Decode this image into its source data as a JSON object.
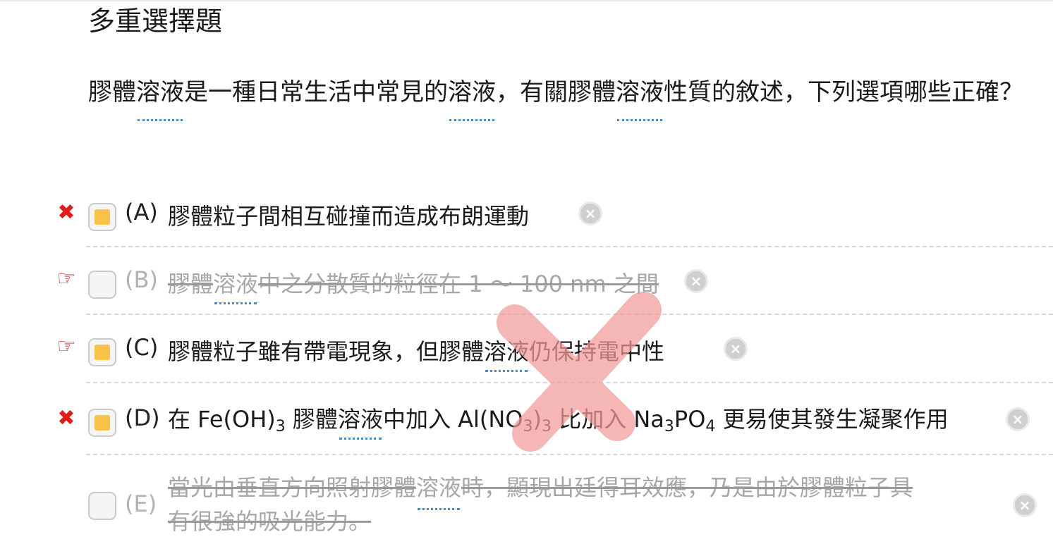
{
  "header": {
    "title": "多重選擇題"
  },
  "question": {
    "p1": "膠體",
    "u1": "溶液",
    "p2": "是一種日常生活中常見的",
    "u2": "溶液",
    "p3": "，有關膠體",
    "u3": "溶液",
    "p4": "性質的敘述，下列選項哪些正確？"
  },
  "options": [
    {
      "letter": "(A)",
      "text": "膠體粒子間相互碰撞而造成布朗運動",
      "mark": "wrong",
      "checked": true
    },
    {
      "letter": "(B)",
      "t1": "膠體",
      "u": "溶液",
      "t2": "中之分散質的粒徑在 1 ～ 100 nm 之間",
      "mark": "hand",
      "checked": false,
      "struck": true
    },
    {
      "letter": "(C)",
      "t1": "膠體粒子雖有帶電現象，但膠體",
      "u": "溶液",
      "t2": "仍保持電中性",
      "mark": "hand",
      "checked": true
    },
    {
      "letter": "(D)",
      "t1": "在 Fe(OH)",
      "s1": "3",
      "t2": " 膠體",
      "u": "溶液",
      "t3": "中加入 Al(NO",
      "s2": "3",
      "t4": ")",
      "s3": "3",
      "t5": " 比加入 Na",
      "s4": "3",
      "t6": "PO",
      "s5": "4",
      "t7": " 更易使其發生凝聚作用",
      "mark": "wrong",
      "checked": true
    },
    {
      "letter": "(E)",
      "t1": "當光由垂直方向照射膠體",
      "u": "溶液",
      "t2": "時，顯現出廷得耳效應，乃是由於膠體粒子具",
      "t3": "有很強的吸光能力。",
      "mark": "none",
      "checked": false,
      "struck": true
    }
  ],
  "marks": {
    "wrong": "✖",
    "hand": "☞",
    "clear": "×"
  },
  "colors": {
    "checkbox_fill": "#f9c349",
    "wrong_mark": "#e01b1b",
    "overlay_x": "#f29a9a",
    "underline": "#3a8fd6"
  },
  "icons": {
    "wrong": "x-icon",
    "hand": "pointing-hand-icon",
    "clear": "clear-circle-icon",
    "overlay": "large-x-overlay-icon"
  }
}
